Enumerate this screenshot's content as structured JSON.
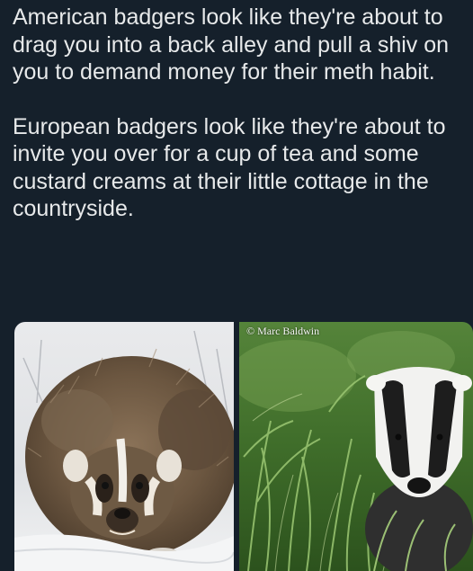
{
  "post": {
    "paragraph_1": "American badgers look like they're about to drag you into a back alley and pull a shiv on you to demand money for their meth habit.",
    "paragraph_2": "European badgers look like they're about to invite you over for a cup of tea and some custard creams at their little cottage in the countryside."
  },
  "photos": {
    "right_credit": "© Marc Baldwin"
  },
  "colors": {
    "background": "#15202b",
    "text": "#e7e9ea"
  }
}
